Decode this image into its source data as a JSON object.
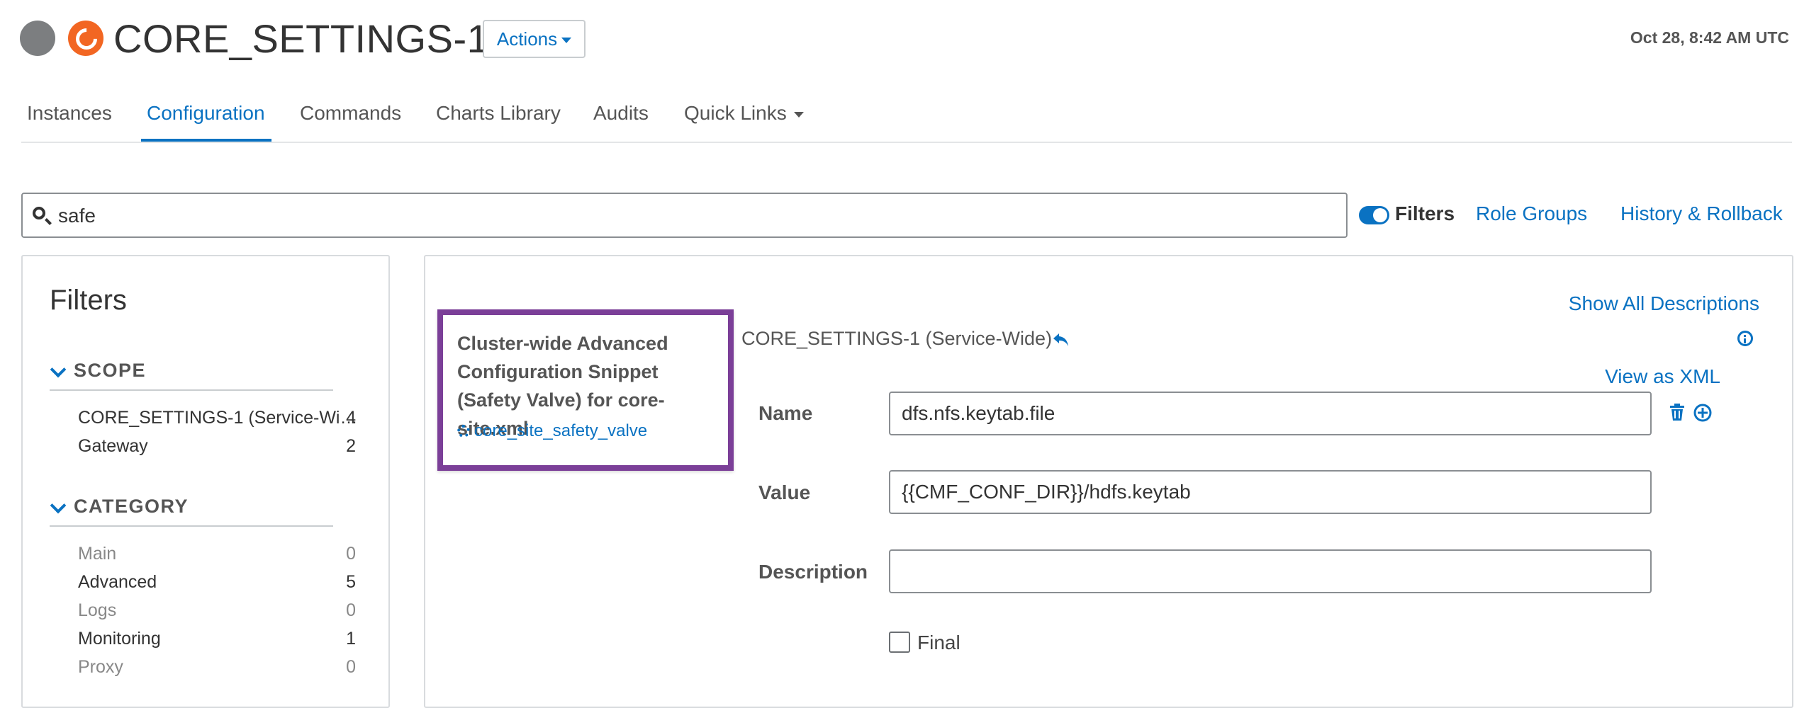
{
  "header": {
    "title": "CORE_SETTINGS-1",
    "actions_label": "Actions",
    "timestamp": "Oct 28, 8:42 AM UTC"
  },
  "tabs": [
    {
      "label": "Instances",
      "active": false
    },
    {
      "label": "Configuration",
      "active": true
    },
    {
      "label": "Commands",
      "active": false
    },
    {
      "label": "Charts Library",
      "active": false
    },
    {
      "label": "Audits",
      "active": false
    },
    {
      "label": "Quick Links",
      "active": false
    }
  ],
  "search": {
    "value": "safe",
    "filters_label": "Filters",
    "filters_on": true,
    "role_groups": "Role Groups",
    "history": "History & Rollback"
  },
  "filters": {
    "title": "Filters",
    "scope": {
      "heading": "SCOPE",
      "items": [
        {
          "label": "CORE_SETTINGS-1 (Service-Wi…",
          "count": "4"
        },
        {
          "label": "Gateway",
          "count": "2"
        }
      ]
    },
    "category": {
      "heading": "CATEGORY",
      "items": [
        {
          "label": "Main",
          "count": "0"
        },
        {
          "label": "Advanced",
          "count": "5"
        },
        {
          "label": "Logs",
          "count": "0"
        },
        {
          "label": "Monitoring",
          "count": "1"
        },
        {
          "label": "Proxy",
          "count": "0"
        }
      ]
    }
  },
  "config": {
    "show_all_descriptions": "Show All Descriptions",
    "property_title": "Cluster-wide Advanced Configuration Snippet (Safety Valve) for core-site.xml",
    "property_key": "core_site_safety_valve",
    "scope_label": "CORE_SETTINGS-1 (Service-Wide)",
    "view_as_xml": "View as XML",
    "name_label": "Name",
    "name_value": "dfs.nfs.keytab.file",
    "value_label": "Value",
    "value_value": "{{CMF_CONF_DIR}}/hdfs.keytab",
    "description_label": "Description",
    "description_value": "",
    "final_label": "Final",
    "final_checked": false
  },
  "colors": {
    "accent": "#0a72c2",
    "highlight_border": "#7b3f98",
    "brand_logo": "#f26622",
    "status_dot": "#7c7e80"
  },
  "icons": [
    "status-dot",
    "service-logo-icon",
    "caret-down-icon",
    "search-icon",
    "toggle-switch",
    "chevron-down-icon",
    "gears-icon",
    "revert-icon",
    "info-icon",
    "trash-icon",
    "add-circle-icon",
    "checkbox"
  ]
}
